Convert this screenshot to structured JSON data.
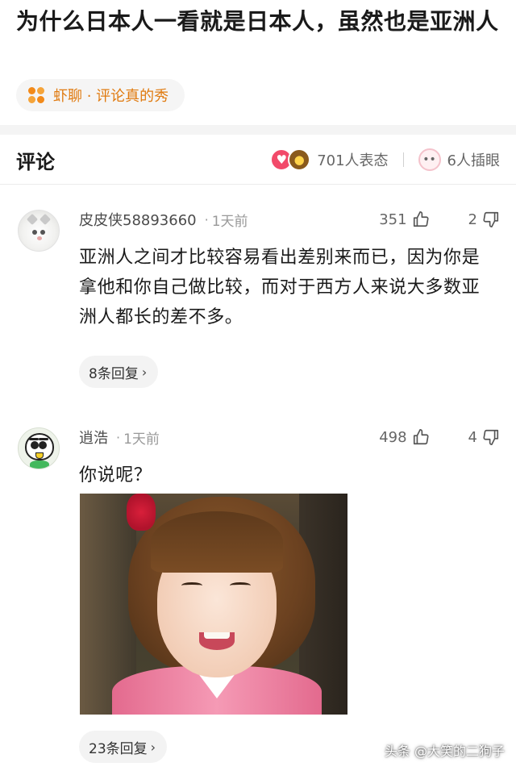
{
  "article": {
    "title": "为什么日本人一看就是日本人，虽然也是亚洲人",
    "source": "虾聊 · 评论真的秀",
    "source_icon": "flower-dots-icon",
    "source_color": "#e07a0f"
  },
  "comments_header": {
    "label": "评论",
    "reactions_count": "701人表态",
    "illustrations_count": "6人插眼",
    "reaction_icons": [
      "heart-emoji-icon",
      "poop-emoji-icon"
    ],
    "illustration_icon": "eyes-emoji-icon"
  },
  "comments": [
    {
      "username": "皮皮侠58893660",
      "dot": "·",
      "time": "1天前",
      "likes": "351",
      "dislikes": "2",
      "text": "亚洲人之间才比较容易看出差别来而已，因为你是拿他和你自己做比较，而对于西方人来说大多数亚洲人都长的差不多。",
      "replies": "8条回复",
      "avatar": "white-cat-avatar"
    },
    {
      "username": "逍浩",
      "dot": "·",
      "time": "1天前",
      "likes": "498",
      "dislikes": "4",
      "text": "你说呢？",
      "replies": "23条回复",
      "avatar": "cartoon-bird-avatar",
      "image": "photo-girl-in-pink-kimono"
    }
  ],
  "watermark": "头条 @大笑的二狗子"
}
